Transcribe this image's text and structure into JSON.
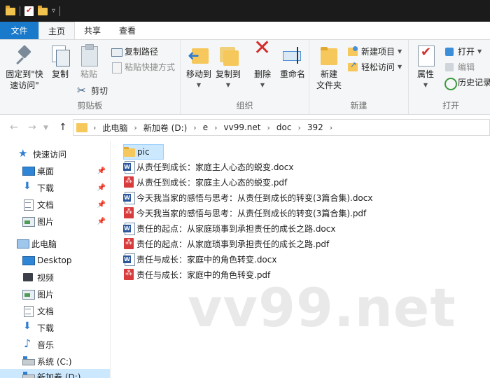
{
  "ribbon_tabs": {
    "file": "文件",
    "home": "主页",
    "share": "共享",
    "view": "查看"
  },
  "clipboard": {
    "pin_label": "固定到\"快\n速访问\"",
    "copy_label": "复制",
    "paste_label": "粘贴",
    "copy_path_label": "复制路径",
    "paste_shortcut_label": "粘贴快捷方式",
    "cut_label": "剪切",
    "group_label": "剪贴板"
  },
  "organize": {
    "move_to_label": "移动到",
    "copy_to_label": "复制到",
    "delete_label": "删除",
    "rename_label": "重命名",
    "group_label": "组织"
  },
  "new": {
    "new_folder_label": "新建\n文件夹",
    "new_item_label": "新建项目",
    "easy_access_label": "轻松访问",
    "group_label": "新建"
  },
  "open": {
    "properties_label": "属性",
    "open_label": "打开",
    "edit_label": "编辑",
    "history_label": "历史记录",
    "group_label": "打开"
  },
  "address": {
    "crumbs": [
      "此电脑",
      "新加卷 (D:)",
      "e",
      "vv99.net",
      "doc",
      "392"
    ]
  },
  "nav_pane": {
    "quick_access": "快速访问",
    "quick_items": [
      "桌面",
      "下载",
      "文档",
      "图片"
    ],
    "this_pc": "此电脑",
    "pc_items": [
      "Desktop",
      "视频",
      "图片",
      "文档",
      "下载",
      "音乐",
      "系统 (C:)",
      "新加卷 (D:)"
    ]
  },
  "files": [
    {
      "name": "pic",
      "type": "folder"
    },
    {
      "name": "从责任到成长：家庭主人心态的蜕变.docx",
      "type": "word"
    },
    {
      "name": "从责任到成长：家庭主人心态的蜕变.pdf",
      "type": "pdf"
    },
    {
      "name": "今天我当家的感悟与思考：从责任到成长的转变(3篇合集).docx",
      "type": "word"
    },
    {
      "name": "今天我当家的感悟与思考：从责任到成长的转变(3篇合集).pdf",
      "type": "pdf"
    },
    {
      "name": "责任的起点：从家庭琐事到承担责任的成长之路.docx",
      "type": "word"
    },
    {
      "name": "责任的起点：从家庭琐事到承担责任的成长之路.pdf",
      "type": "pdf"
    },
    {
      "name": "责任与成长：家庭中的角色转变.docx",
      "type": "word"
    },
    {
      "name": "责任与成长：家庭中的角色转变.pdf",
      "type": "pdf"
    }
  ],
  "watermark": "vv99.net",
  "colors": {
    "file_tab": "#1979ca",
    "selection": "#cce8ff",
    "folder": "#f6c75a",
    "pdf": "#d83b3b",
    "word": "#2b579a"
  }
}
